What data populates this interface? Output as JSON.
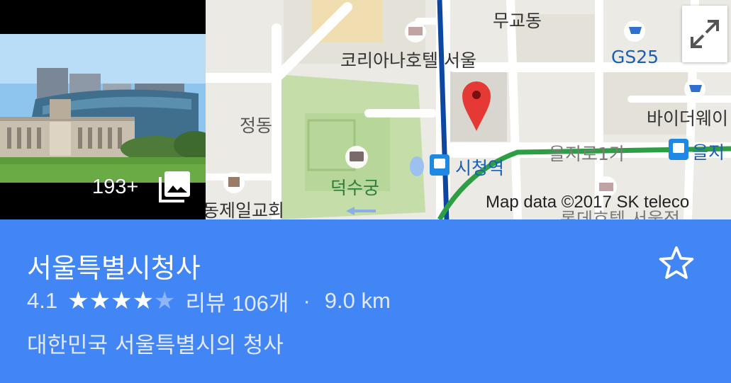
{
  "photo": {
    "count_label": "193+",
    "icon": "photo-library-icon"
  },
  "map": {
    "labels": {
      "mugyo_dong": "무교동",
      "koreana_hotel": "코리아나호텔 서울",
      "gs25": "GS25",
      "jeong_dong": "정동",
      "buy_the_way": "바이더웨이",
      "deoksugung": "덕수궁",
      "city_hall_station": "시청역",
      "euljiro_1ga": "을지로1가",
      "euljiro_station": "을지",
      "jeongdong_church": "동제일교회",
      "hotel_bottom": "롯데호텔 서울점"
    },
    "copyright": "Map data ©2017 SK teleco",
    "marker_color": "#e53935",
    "subway_line1_color": "#0d47a1",
    "subway_line2_color": "#2e9e45",
    "expand_icon": "expand-icon"
  },
  "place": {
    "name": "서울특별시청사",
    "rating": "4.1",
    "stars_filled": 4,
    "stars_total": 5,
    "reviews": "리뷰 106개",
    "separator": "·",
    "distance": "9.0 km",
    "description": "대한민국 서울특별시의 청사",
    "star_icon": "star-outline-icon"
  },
  "colors": {
    "panel": "#4285f4"
  }
}
